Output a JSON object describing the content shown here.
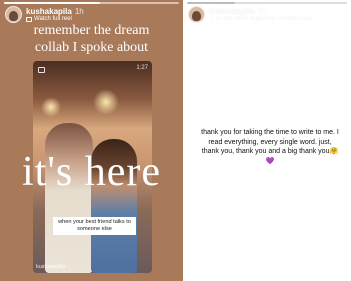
{
  "left_story": {
    "username": "kushakapila",
    "time": "1h",
    "watch_label": "Watch full reel",
    "headline_line1": "remember the dream",
    "headline_line2": "collab I spoke about",
    "big_text": "it's here",
    "reel_time": "1:27",
    "caption_line1": "when your best friend talks to",
    "caption_line2": "someone else",
    "watermark": "kushakapila",
    "progress": 0.55
  },
  "right_story": {
    "username": "kushakapila",
    "time": "1h",
    "subtitle": "♫ Tu Hai Mera Superstar • Ashwin Das",
    "message": "thank you for taking the time to write to me. I read everything, every single word. just, thank you, thank you and a big thank you🤗💜",
    "progress": 0.3
  }
}
